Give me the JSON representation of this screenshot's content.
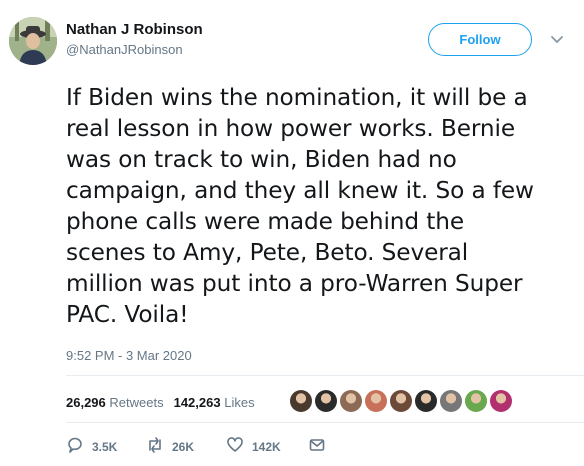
{
  "author": {
    "name": "Nathan J Robinson",
    "handle": "@NathanJRobinson"
  },
  "follow_label": "Follow",
  "tweet": {
    "text": "If Biden wins the nomination, it will be a\nreal lesson in how power works. Bernie\nwas on track to win, Biden had no\ncampaign, and they all knew it. So a few\nphone calls were made behind the\nscenes to Amy, Pete, Beto. Several\nmillion was put into a pro-Warren Super\nPAC. Voila!",
    "timestamp": "9:52 PM - 3 Mar 2020"
  },
  "stats": {
    "retweets_count": "26,296",
    "retweets_label": "Retweets",
    "likes_count": "142,263",
    "likes_label": "Likes"
  },
  "liker_colors": [
    "#4a3a2e",
    "#2b2b2b",
    "#8c6a55",
    "#c8705a",
    "#6b4a3a",
    "#2a2a2a",
    "#777777",
    "#6aa84f",
    "#b3306e"
  ],
  "actions": {
    "replies": "3.5K",
    "retweets": "26K",
    "likes": "142K"
  },
  "colors": {
    "accent": "#1da1f2",
    "muted": "#657786"
  }
}
